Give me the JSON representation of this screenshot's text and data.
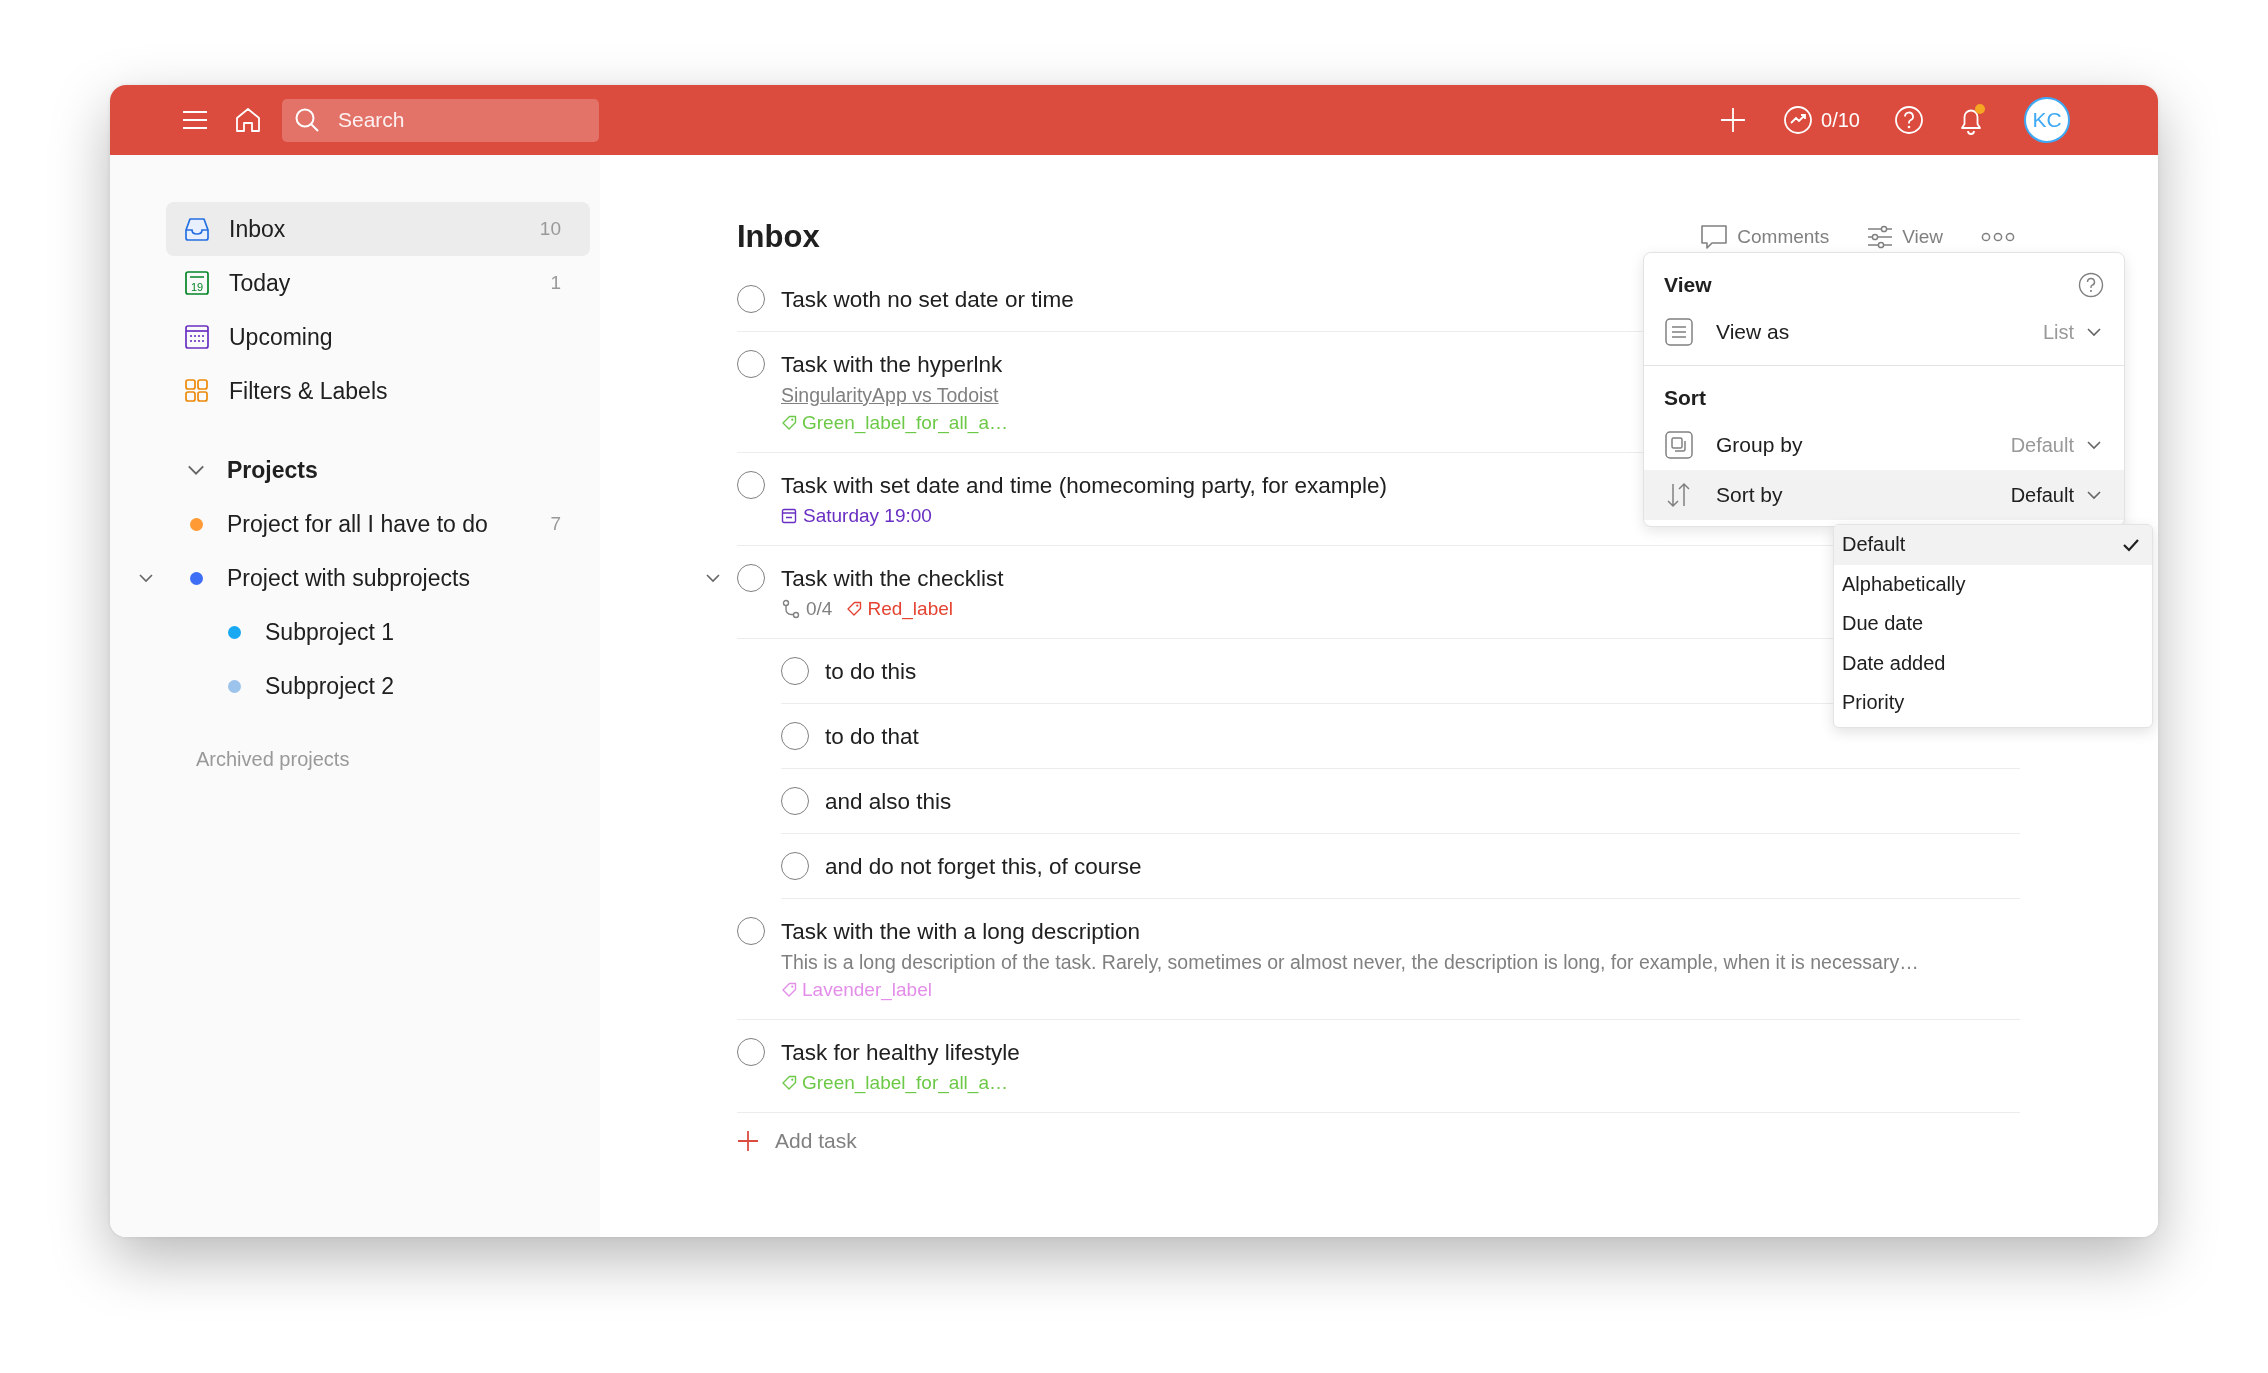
{
  "topbar": {
    "search": {
      "placeholder": "Search"
    },
    "karma": "0/10",
    "avatar": "KC"
  },
  "sidebar": {
    "items": [
      {
        "kind": "inbox",
        "label": "Inbox",
        "count": "10",
        "selected": true
      },
      {
        "kind": "today",
        "label": "Today",
        "icon_text": "19",
        "count": "1",
        "selected": false
      },
      {
        "kind": "upcoming",
        "label": "Upcoming",
        "selected": false
      },
      {
        "kind": "filters",
        "label": "Filters & Labels",
        "selected": false
      }
    ],
    "projects_section": {
      "title": "Projects",
      "expanded": true
    },
    "projects": [
      {
        "label": "Project for all I have to do",
        "count": "7",
        "color": "#ff9a35",
        "selected": false
      },
      {
        "label": "Project with subprojects",
        "color": "#3d6ef5",
        "selected": false,
        "expanded": true,
        "children": [
          {
            "label": "Subproject 1",
            "color": "#19a9f2",
            "selected": false
          },
          {
            "label": "Subproject 2",
            "color": "#9cc3ec",
            "selected": false
          }
        ]
      }
    ],
    "archived": "Archived projects"
  },
  "main": {
    "title": "Inbox",
    "actions": [
      {
        "kind": "comments",
        "label": "Comments"
      },
      {
        "kind": "view",
        "label": "View"
      }
    ],
    "tasks": [
      {
        "title": "Task woth no set date or time",
        "checked": false
      },
      {
        "title": "Task with the hyperlnk",
        "checked": false,
        "link": "SingularityApp vs Todoist",
        "labels": [
          {
            "text": "Green_label_for_all_a…",
            "color": "#6cc947"
          }
        ]
      },
      {
        "title": "Task with set date and time (homecoming party, for example)",
        "checked": false,
        "date": "Saturday 19:00"
      },
      {
        "title": "Task with the checklist",
        "checked": false,
        "expanded": true,
        "subtasks": "0/4",
        "labels": [
          {
            "text": "Red_label",
            "color": "#e44332"
          }
        ],
        "children": [
          {
            "title": "to do this",
            "checked": false
          },
          {
            "title": "to do that",
            "checked": false
          },
          {
            "title": "and also this",
            "checked": false
          },
          {
            "title": "and do not forget this, of course",
            "checked": false
          }
        ]
      },
      {
        "title": "Task with the with a long description",
        "checked": false,
        "description": "This is a long description of the task. Rarely, sometimes or almost never, the description is long, for example, when it is necessary…",
        "labels": [
          {
            "text": "Lavender_label",
            "color": "#e38ee9"
          }
        ]
      },
      {
        "title": "Task for healthy lifestyle",
        "checked": false,
        "labels": [
          {
            "text": "Green_label_for_all_a…",
            "color": "#6cc947"
          }
        ]
      }
    ],
    "add_task": "Add task"
  },
  "view_panel": {
    "title": "View",
    "view_as": {
      "kind": "list",
      "label": "View as",
      "value": "List",
      "selected": false
    },
    "sort_title": "Sort",
    "rows": [
      {
        "kind": "group",
        "label": "Group by",
        "value": "Default",
        "selected": false
      },
      {
        "kind": "sort",
        "label": "Sort by",
        "value": "Default",
        "selected": true
      }
    ]
  },
  "sort_menu": {
    "options": [
      {
        "label": "Default",
        "selected": true
      },
      {
        "label": "Alphabetically",
        "selected": false
      },
      {
        "label": "Due date",
        "selected": false
      },
      {
        "label": "Date added",
        "selected": false
      },
      {
        "label": "Priority",
        "selected": false
      }
    ]
  }
}
